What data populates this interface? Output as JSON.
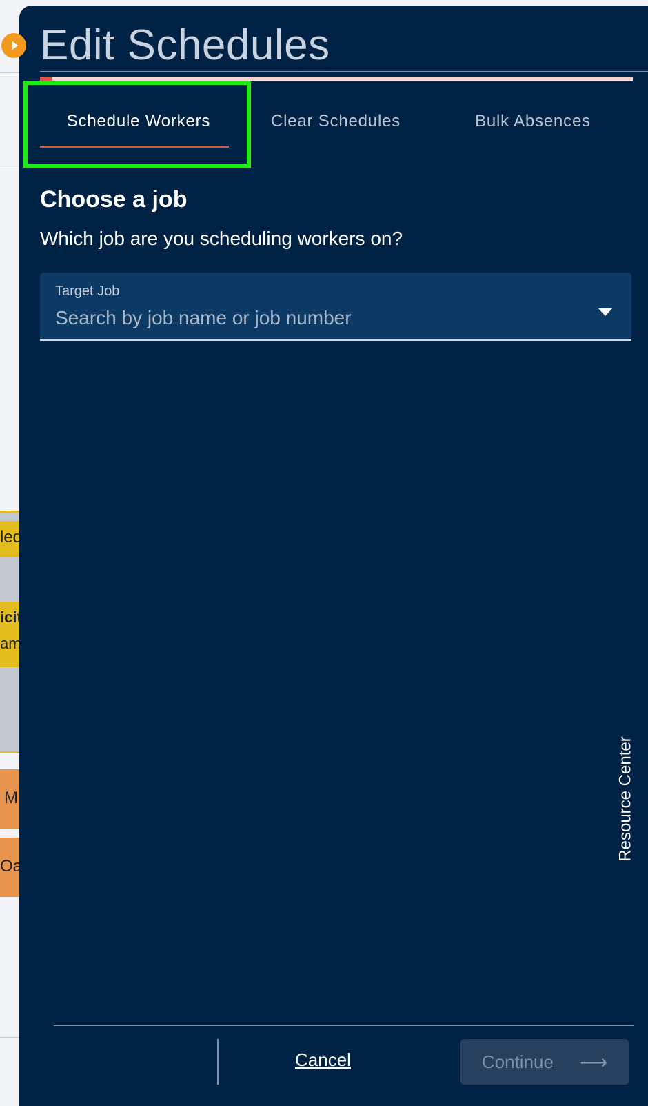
{
  "panel": {
    "title": "Edit Schedules",
    "progress_fraction": 0.02,
    "tabs": [
      {
        "label": "Schedule Workers",
        "active": true
      },
      {
        "label": "Clear Schedules",
        "active": false
      },
      {
        "label": "Bulk Absences",
        "active": false
      }
    ],
    "section": {
      "heading": "Choose a job",
      "subheading": "Which job are you scheduling workers on?"
    },
    "target_job": {
      "label": "Target Job",
      "placeholder": "Search by job name or job number"
    },
    "resource_center_label": "Resource Center",
    "footer": {
      "cancel_label": "Cancel",
      "continue_label": "Continue"
    }
  },
  "background_fragments": [
    "led",
    "icit",
    "am",
    "M",
    "Oa"
  ],
  "colors": {
    "panel_bg": "#002244",
    "accent": "#e0534a",
    "focus_highlight": "#20e812",
    "expand_dot": "#f39a1e",
    "card_yellow": "#e3bd1d",
    "card_orange": "#e7944e"
  }
}
